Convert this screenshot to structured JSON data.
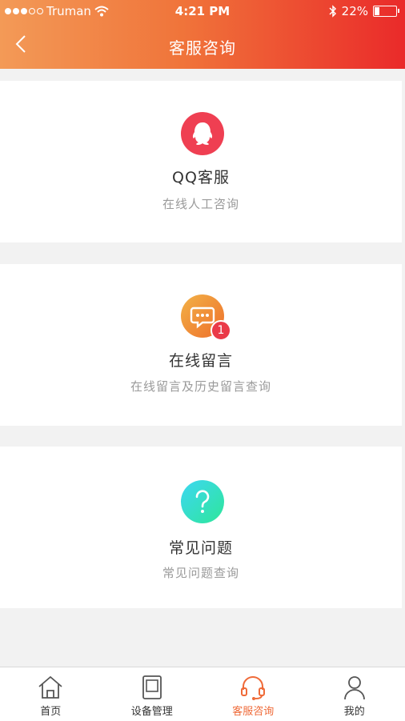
{
  "status_bar": {
    "carrier": "Truman",
    "time": "4:21 PM",
    "battery_percent_text": "22%",
    "battery_level": 0.22
  },
  "nav": {
    "title": "客服咨询"
  },
  "services": [
    {
      "name": "QQ客服",
      "desc": "在线人工咨询",
      "icon": "qq-icon",
      "color": "#ef3f52"
    },
    {
      "name": "在线留言",
      "desc": "在线留言及历史留言查询",
      "icon": "message-icon",
      "color": "#f08a2a",
      "badge": "1"
    },
    {
      "name": "常见问题",
      "desc": "常见问题查询",
      "icon": "question-icon",
      "color": "#2ee6a8"
    }
  ],
  "tabs": [
    {
      "label": "首页",
      "icon": "home-icon"
    },
    {
      "label": "设备管理",
      "icon": "device-icon"
    },
    {
      "label": "客服咨询",
      "icon": "headset-icon",
      "active": true
    },
    {
      "label": "我的",
      "icon": "user-icon"
    }
  ],
  "colors": {
    "header_gradient_start": "#f39a57",
    "header_gradient_end": "#ea2a2a",
    "active_tab": "#ef6a38"
  }
}
